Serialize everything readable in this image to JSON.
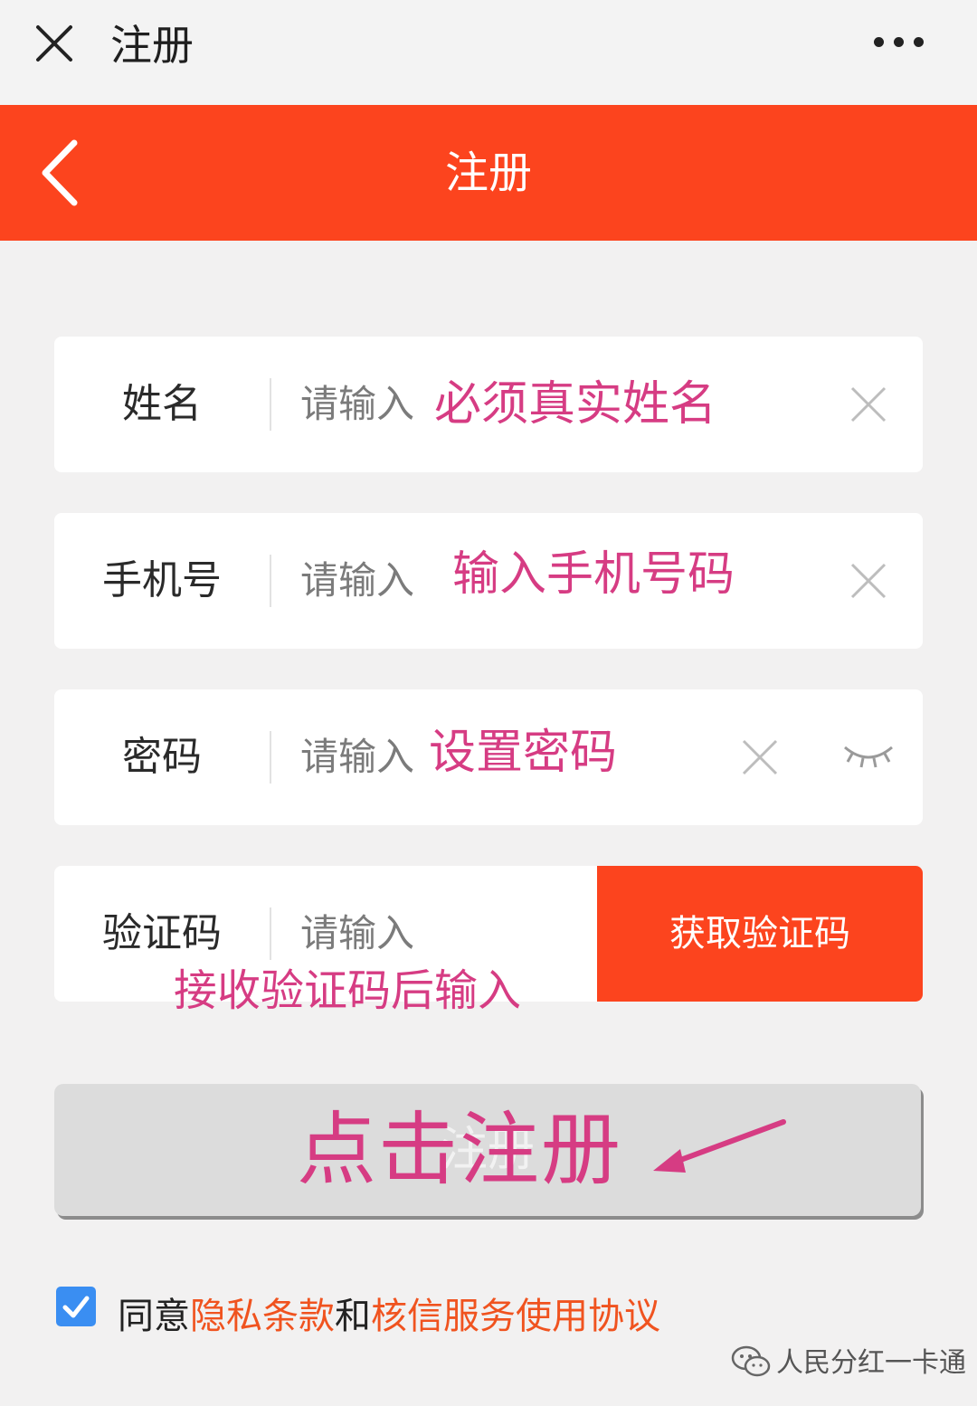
{
  "topbar": {
    "title": "注册"
  },
  "header": {
    "title": "注册"
  },
  "form": {
    "name": {
      "label": "姓名",
      "placeholder": "请输入",
      "annotation": "必须真实姓名"
    },
    "phone": {
      "label": "手机号",
      "placeholder": "请输入",
      "annotation": "输入手机号码"
    },
    "password": {
      "label": "密码",
      "placeholder": "请输入",
      "annotation": "设置密码"
    },
    "code": {
      "label": "验证码",
      "placeholder": "请输入",
      "button": "获取验证码",
      "annotation": "接收验证码后输入"
    }
  },
  "register": {
    "label": "注册",
    "annotation": "点击注册"
  },
  "agreement": {
    "checked": true,
    "prefix": "同意",
    "privacy": "隐私条款",
    "and": "和",
    "service": "核信服务使用协议"
  },
  "watermark": {
    "text": "人民分红一卡通"
  },
  "colors": {
    "accent": "#fc441e",
    "annotation": "#d63c83",
    "link": "#f0531f",
    "checkbox": "#3a8ef2"
  }
}
